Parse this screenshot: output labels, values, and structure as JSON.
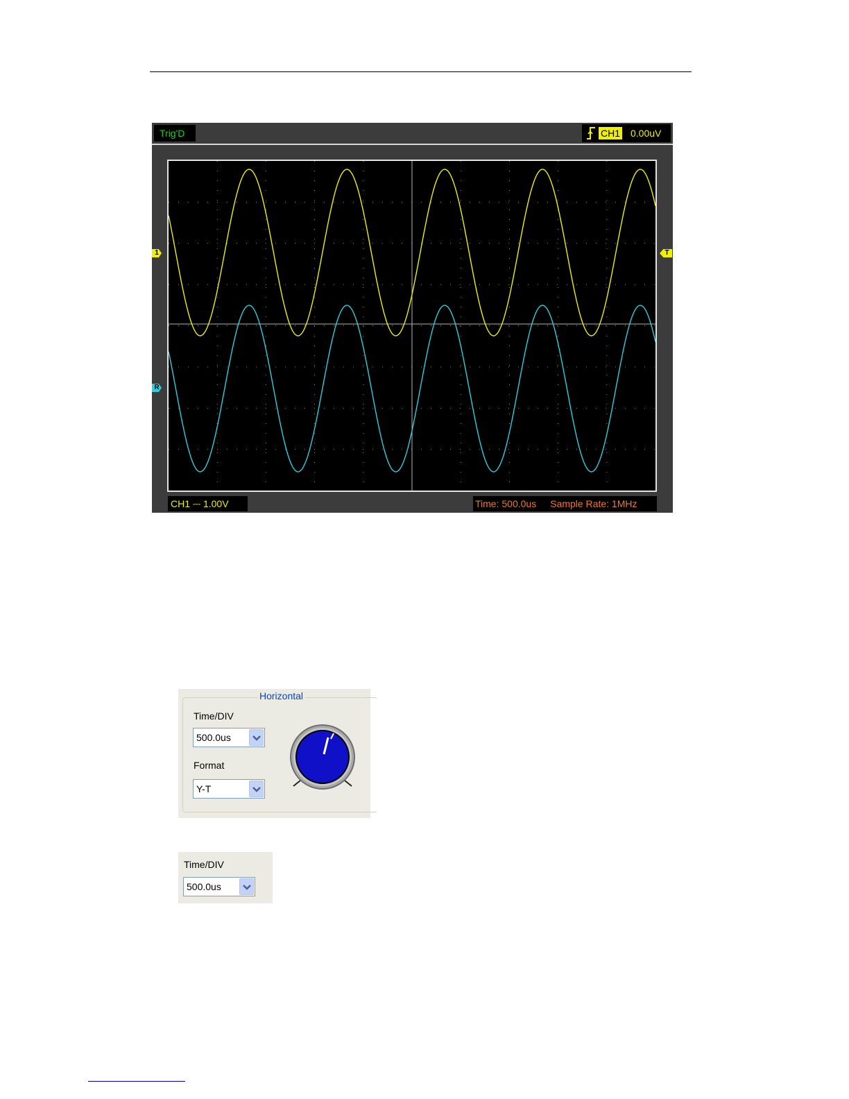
{
  "scope": {
    "trig_status": "Trig'D",
    "trigger": {
      "icon": "rising-edge-icon",
      "source": "CH1",
      "level": "0.00uV"
    },
    "markers": {
      "ch1": "1",
      "ref": "R",
      "trigger": "T"
    },
    "channel_scale": "CH1 ⎓ 1.00V",
    "time": "Time: 500.0us",
    "sample_rate": "Sample Rate: 1MHz",
    "colors": {
      "ch1": "#f0f000",
      "ref": "#28d0e0",
      "trigger_status": "#18d018",
      "time_info": "#f07820"
    }
  },
  "horizontal": {
    "title": "Horizontal",
    "timediv_label": "Time/DIV",
    "timediv_value": "500.0us",
    "format_label": "Format",
    "format_value": "Y-T"
  },
  "timediv_closeup": {
    "label": "Time/DIV",
    "value": "500.0us"
  }
}
